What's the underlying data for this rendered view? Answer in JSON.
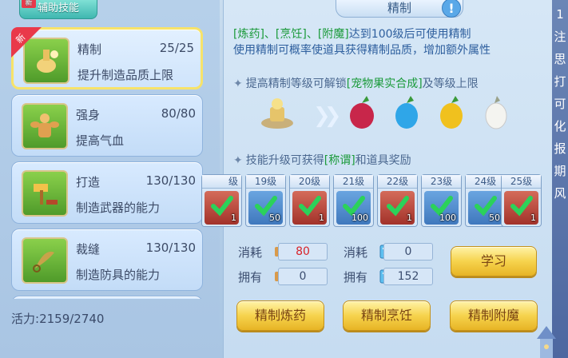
{
  "top_tab": {
    "label": "辅助技能",
    "badge": "新"
  },
  "panel_title": "精制",
  "skills": [
    {
      "name": "精制",
      "level": "25/25",
      "desc": "提升制造品质上限",
      "badge": "新"
    },
    {
      "name": "强身",
      "level": "80/80",
      "desc": "提高气血"
    },
    {
      "name": "打造",
      "level": "130/130",
      "desc": "制造武器的能力"
    },
    {
      "name": "裁缝",
      "level": "130/130",
      "desc": "制造防具的能力"
    }
  ],
  "vigor": {
    "label": "活力:",
    "value": "2159/2740"
  },
  "info": {
    "line1_a": "[炼药]、[烹饪]、[附魔]",
    "line1_b": "达到100级后可使用精制",
    "line2": "使用精制可概率使道具获得精制品质，增加额外属性"
  },
  "unlock": {
    "prefix": "提高精制等级可解锁",
    "highlight": "[宠物果实合成]",
    "suffix": "及等级上限"
  },
  "reward": {
    "prefix": "技能升级可获得",
    "highlight": "[称谓]",
    "suffix": "和道具奖励"
  },
  "levels": [
    {
      "label": "级",
      "count": "1",
      "style": "red"
    },
    {
      "label": "19级",
      "count": "50",
      "style": "blue"
    },
    {
      "label": "20级",
      "count": "1",
      "style": "red"
    },
    {
      "label": "21级",
      "count": "100",
      "style": "blue"
    },
    {
      "label": "22级",
      "count": "1",
      "style": "red"
    },
    {
      "label": "23级",
      "count": "100",
      "style": "blue"
    },
    {
      "label": "24级",
      "count": "50",
      "style": "blue"
    },
    {
      "label": "25级",
      "count": "1",
      "style": "red"
    }
  ],
  "costs": {
    "consume_label": "消耗",
    "own_label": "拥有",
    "left_consume": "80",
    "left_own": "0",
    "right_consume": "0",
    "right_own": "152"
  },
  "buttons": {
    "learn": "学习",
    "alchemy": "精制炼药",
    "cooking": "精制烹饪",
    "enchant": "精制附魔"
  },
  "edge_text": [
    "1",
    "注",
    "思",
    "打",
    "可",
    "化",
    "报",
    "期",
    "风"
  ]
}
